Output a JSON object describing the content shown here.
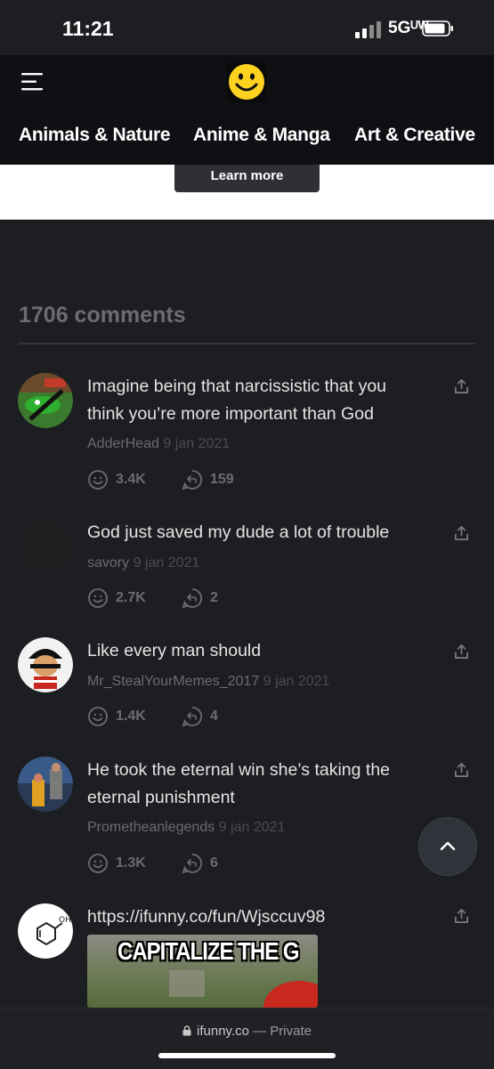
{
  "status": {
    "time": "11:21",
    "network": "5Gᵁᵂ"
  },
  "header": {
    "categories": [
      "Animals & Nature",
      "Anime & Manga",
      "Art & Creative"
    ]
  },
  "ad": {
    "button_label": "Learn more"
  },
  "comments_section": {
    "count_label": "1706 comments",
    "comments": [
      {
        "text": "Imagine being that narcissistic that you think you’re more important than God",
        "author": "AdderHead",
        "date": "9 jan 2021",
        "smiles": "3.4K",
        "replies": "159"
      },
      {
        "text": "God just saved my dude a lot of trouble",
        "author": "savory",
        "date": "9 jan 2021",
        "smiles": "2.7K",
        "replies": "2"
      },
      {
        "text": "Like every man should",
        "author": "Mr_StealYourMemes_2017",
        "date": "9 jan 2021",
        "smiles": "1.4K",
        "replies": "4"
      },
      {
        "text": "He took the eternal win she’s taking the eternal punishment",
        "author": "Prometheanlegends",
        "date": "9 jan 2021",
        "smiles": "1.3K",
        "replies": "6"
      },
      {
        "text": "https://ifunny.co/fun/Wjsccuv98",
        "meme_caption": "CAPITALIZE THE G"
      }
    ]
  },
  "browser": {
    "domain": "ifunny.co",
    "separator": " — ",
    "mode": "Private"
  },
  "colors": {
    "background": "#1d1e22",
    "header": "#0e1014",
    "muted": "#6a6c71",
    "logo_yellow": "#ffd21f"
  }
}
